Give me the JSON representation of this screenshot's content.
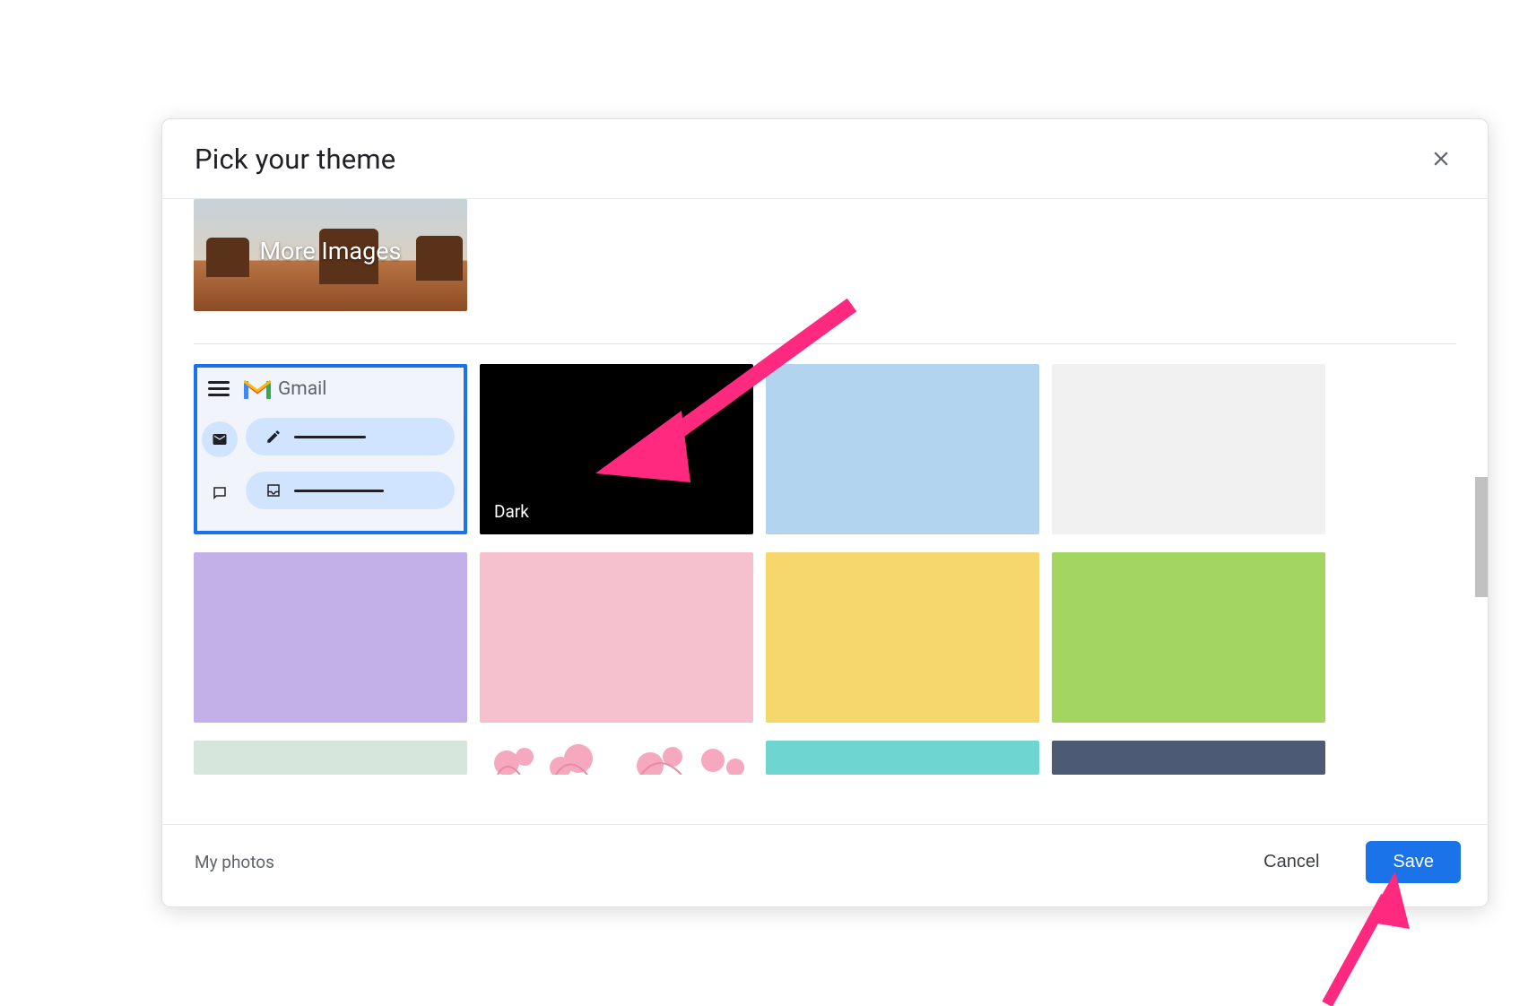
{
  "dialog": {
    "title": "Pick your theme",
    "more_images_label": "More Images",
    "themes": {
      "row1": [
        {
          "name": "Default",
          "selected": true,
          "gmail_label": "Gmail"
        },
        {
          "name": "Dark",
          "color": "#000000",
          "label": "Dark"
        },
        {
          "name": "LightBlue",
          "color": "#b2d4ef"
        },
        {
          "name": "LightGray",
          "color": "#f1f1f1"
        }
      ],
      "row2": [
        {
          "name": "Lavender",
          "color": "#c4b0e8"
        },
        {
          "name": "Pink",
          "color": "#f6c1cf"
        },
        {
          "name": "Mustard",
          "color": "#f6d76b"
        },
        {
          "name": "Green",
          "color": "#a3d661"
        }
      ],
      "row3": [
        {
          "name": "Mint",
          "color": "#d6e6dc"
        },
        {
          "name": "CherryBlossom"
        },
        {
          "name": "Teal",
          "color": "#6fd5d1"
        },
        {
          "name": "SlateBlue",
          "color": "#4c5a75"
        }
      ]
    },
    "footer": {
      "my_photos": "My photos",
      "cancel": "Cancel",
      "save": "Save"
    }
  },
  "annotation": {
    "arrow_color": "#ff2a7f"
  }
}
